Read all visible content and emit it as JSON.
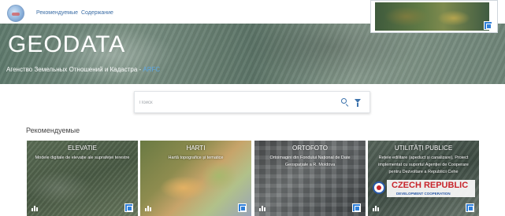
{
  "header": {
    "nav": [
      "Рекомендуемые",
      "Содержание"
    ]
  },
  "hero": {
    "title": "GEODATA",
    "subtitle": "Агенство Земельных Отношений и Кадастра - ",
    "acronym": "ARFC"
  },
  "search": {
    "placeholder": "Поиск"
  },
  "recommended": {
    "title": "Рекомендуемые",
    "cards": [
      {
        "title": "ELEVATIE",
        "desc": "Modele digitale de elevație ale suprafeței terestre"
      },
      {
        "title": "HARTI",
        "desc": "Hartă topografice și tematice"
      },
      {
        "title": "ORTOFOTO",
        "desc": "Ortoimagini din Fondului Național de Date Geospațiale a R. Moldova"
      },
      {
        "title": "UTILITĂȚI PUBLICE",
        "desc": "Rețele edilitare (apeduct și canalizare), Proiect implementat cu suportul Agenției de Cooperare pentru Dezvoltare a Republicii Cehe"
      }
    ],
    "badge": {
      "text": "CZECH REPUBLIC",
      "subtext": "DEVELOPMENT COOPERATION"
    }
  },
  "colors": {
    "accent": "#2f7fd8",
    "link": "#3c6ea6",
    "acronym": "#5aa7e6",
    "badge_red": "#c8242b"
  }
}
